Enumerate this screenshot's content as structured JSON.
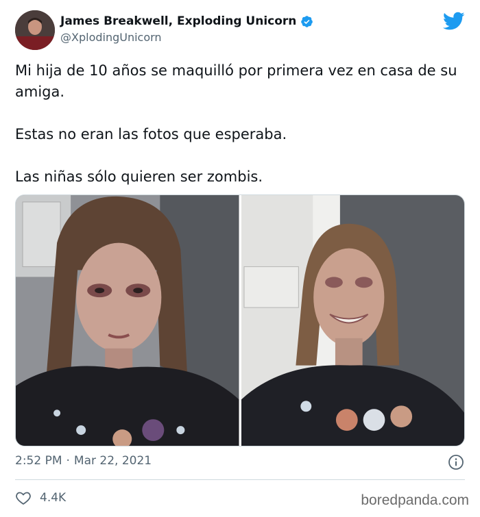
{
  "author": {
    "display_name": "James Breakwell, Exploding Unicorn",
    "handle": "@XplodingUnicorn",
    "verified": true
  },
  "tweet": {
    "paragraphs": [
      "Mi hija de 10 años se maquilló por primera vez en casa de su amiga.",
      "Estas no eran las fotos que esperaba.",
      "Las niñas sólo quieren ser zombis."
    ],
    "time": "2:52 PM",
    "separator": "·",
    "date": "Mar 22, 2021"
  },
  "media": {
    "photos": [
      {
        "alt": "girl-zombie-makeup-serious"
      },
      {
        "alt": "girl-zombie-makeup-smiling"
      }
    ]
  },
  "engagement": {
    "likes": "4.4K"
  },
  "watermark": "boredpanda.com",
  "colors": {
    "text": "#0f1419",
    "secondary": "#536471",
    "twitter_blue": "#1d9bf0",
    "divider": "#cfd9de"
  },
  "icons": [
    "verified-badge-icon",
    "twitter-bird-icon",
    "info-icon",
    "heart-icon"
  ]
}
